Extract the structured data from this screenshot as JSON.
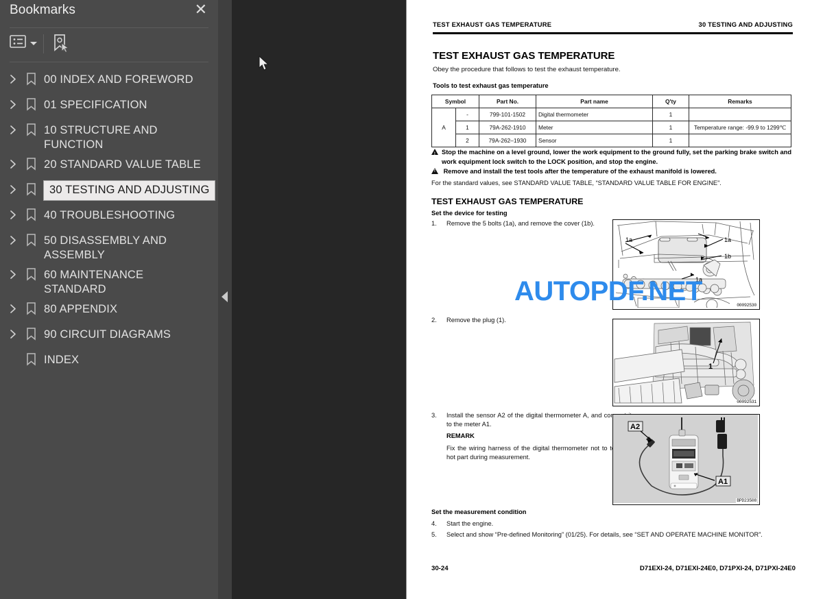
{
  "sidebar": {
    "title": "Bookmarks",
    "close_label": "✕",
    "toolbar": {
      "list_options_icon": "list-options-icon",
      "dropdown_caret_icon": "chevron-down-icon",
      "new_bookmark_icon": "bookmark-pointer-icon"
    },
    "items": [
      {
        "label": "00 INDEX AND FOREWORD",
        "expandable": true,
        "selected": false
      },
      {
        "label": "01 SPECIFICATION",
        "expandable": true,
        "selected": false
      },
      {
        "label": "10 STRUCTURE AND FUNCTION",
        "expandable": true,
        "selected": false
      },
      {
        "label": "20 STANDARD VALUE TABLE",
        "expandable": true,
        "selected": false
      },
      {
        "label": "30 TESTING AND ADJUSTING",
        "expandable": true,
        "selected": true
      },
      {
        "label": "40 TROUBLESHOOTING",
        "expandable": true,
        "selected": false
      },
      {
        "label": "50 DISASSEMBLY AND ASSEMBLY",
        "expandable": true,
        "selected": false
      },
      {
        "label": "60 MAINTENANCE STANDARD",
        "expandable": true,
        "selected": false
      },
      {
        "label": "80 APPENDIX",
        "expandable": true,
        "selected": false
      },
      {
        "label": "90 CIRCUIT DIAGRAMS",
        "expandable": true,
        "selected": false
      },
      {
        "label": "INDEX",
        "expandable": false,
        "selected": false
      }
    ],
    "collapse_handle": "collapse-sidebar-handle"
  },
  "watermark": {
    "text": "AUTOPDF.NET",
    "color": "#2e8bec"
  },
  "page": {
    "running_head_left": "TEST EXHAUST GAS TEMPERATURE",
    "running_head_right": "30 TESTING AND ADJUSTING",
    "title": "TEST EXHAUST GAS TEMPERATURE",
    "lead": "Obey the procedure that follows to test the exhaust temperature.",
    "tools_heading": "Tools to test exhaust gas temperature",
    "tools_table": {
      "headers": [
        "Symbol",
        "Part No.",
        "Part name",
        "Q'ty",
        "Remarks"
      ],
      "symbol_group": "A",
      "rows": [
        {
          "no": "-",
          "part_no": "799-101-1502",
          "part_name": "Digital thermometer",
          "qty": "1",
          "remarks": ""
        },
        {
          "no": "1",
          "part_no": "79A-262-1910",
          "part_name": "Meter",
          "qty": "1",
          "remarks": "Temperature range: -99.9 to 1299℃"
        },
        {
          "no": "2",
          "part_no": "79A-262–1930",
          "part_name": "Sensor",
          "qty": "1",
          "remarks": ""
        }
      ]
    },
    "warnings": [
      "Stop the machine on a level ground, lower the work equipment to the ground fully, set the parking brake switch and work equipment lock switch to the LOCK position, and stop the engine.",
      "Remove and install the test tools after the temperature of the exhaust manifold is lowered."
    ],
    "standard_values_note": "For the standard values, see STANDARD VALUE TABLE, “STANDARD VALUE TABLE FOR ENGINE”.",
    "section_title": "TEST EXHAUST GAS TEMPERATURE",
    "subhead_setup": "Set the device for testing",
    "subhead_measure": "Set the measurement condition",
    "steps": [
      {
        "num": "1.",
        "text": "Remove the 5 bolts (1a), and remove the cover (1b)."
      },
      {
        "num": "2.",
        "text": "Remove the plug (1)."
      },
      {
        "num": "3.",
        "text": "Install the sensor A2 of the digital thermometer A, and connect it to the meter A1."
      },
      {
        "num": "4.",
        "text": "Start the engine."
      },
      {
        "num": "5.",
        "text": "Select and show “Pre-defined Monitoring” (01/25). For details, see “SET AND OPERATE MACHINE MONITOR”."
      }
    ],
    "remark_heading": "REMARK",
    "remark_text": "Fix the wiring harness of the digital thermometer not to touch a hot part during measurement.",
    "figures": [
      {
        "id": "00092530",
        "callouts": [
          "1a",
          "1a",
          "1a",
          "1b"
        ],
        "kind": "line-drawing-machine-cover"
      },
      {
        "id": "00092531",
        "callouts": [
          "1"
        ],
        "kind": "line-drawing-engine-plug"
      },
      {
        "id": "BPD23508",
        "callouts": [
          "A2",
          "A1"
        ],
        "kind": "photo-digital-thermometer"
      }
    ],
    "footer_left": "30-24",
    "footer_right": "D71EXI-24, D71EXI-24E0, D71PXI-24, D71PXI-24E0"
  }
}
